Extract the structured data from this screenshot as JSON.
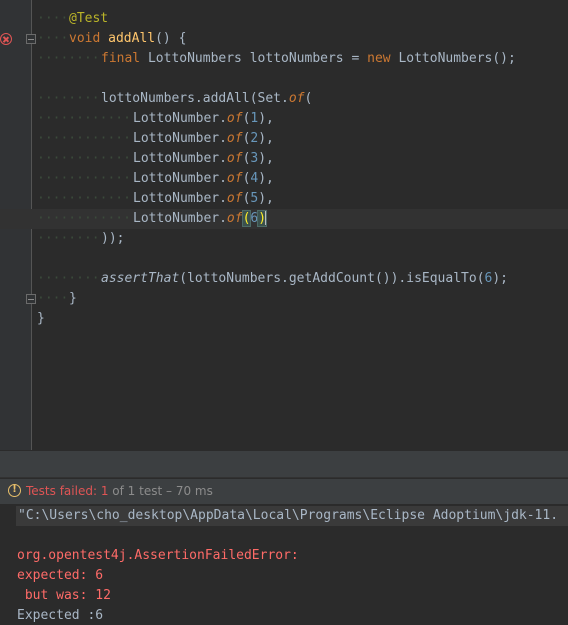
{
  "editor": {
    "annotation": "@Test",
    "kw_void": "void",
    "method_name": "addAll",
    "method_params": "() {",
    "kw_final": "final",
    "decl_type_var": "LottoNumbers lottoNumbers = ",
    "kw_new": "new",
    "ctor_call": "LottoNumbers();",
    "add_call_prefix": "lottoNumbers.addAll(Set.",
    "of_method": "of",
    "of_paren": "(",
    "element_prefix": "LottoNumber.",
    "elements": [
      {
        "open": "(",
        "value": "1",
        "close": "),"
      },
      {
        "open": "(",
        "value": "2",
        "close": "),"
      },
      {
        "open": "(",
        "value": "3",
        "close": "),"
      },
      {
        "open": "(",
        "value": "4",
        "close": "),"
      },
      {
        "open": "(",
        "value": "5",
        "close": "),"
      },
      {
        "open": "(",
        "value": "6",
        "close": ")"
      }
    ],
    "close_call": "));",
    "assert_method": "assertThat",
    "assert_arg": "(lottoNumbers.getAddCount()).isEqualTo(",
    "assert_expected": "6",
    "assert_end": ");",
    "method_close": "}",
    "class_close": "}"
  },
  "status": {
    "failed_label": "Tests failed:",
    "failed_count": "1",
    "of_total": "of 1 test",
    "duration": "– 70 ms",
    "icon": "warning-circle-icon"
  },
  "console": {
    "command": "\"C:\\Users\\cho_desktop\\AppData\\Local\\Programs\\Eclipse Adoptium\\jdk-11.",
    "error_class": "org.opentest4j.AssertionFailedError:",
    "expected_line": "expected: 6",
    "but_was_line": " but was: 12",
    "expected_summary": "Expected :6"
  },
  "colors": {
    "keyword": "#cc7832",
    "function": "#ffc66d",
    "annotation": "#bbb529",
    "number": "#6897bb",
    "error": "#ff6b68",
    "warning": "#e8bf6a"
  }
}
